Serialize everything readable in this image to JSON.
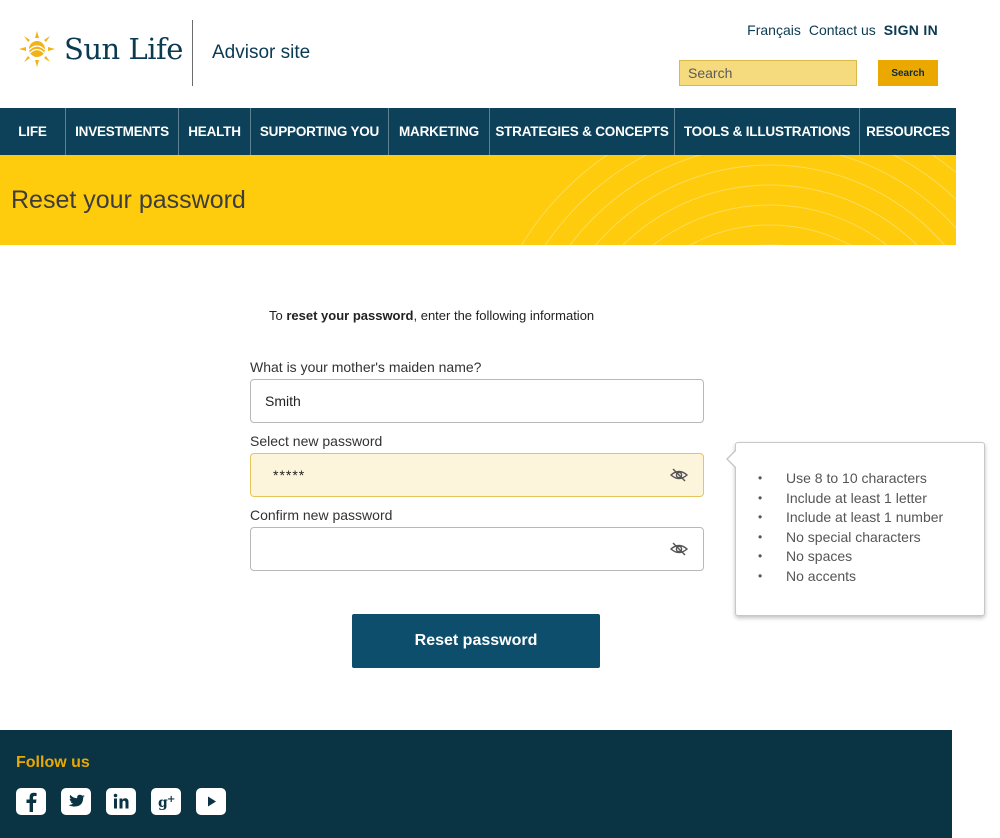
{
  "header": {
    "brand": "Sun Life",
    "site_name": "Advisor site",
    "links": {
      "francais": "Français",
      "contact": "Contact us",
      "signin": "SIGN IN"
    },
    "search": {
      "placeholder": "Search",
      "button_label": "Search"
    }
  },
  "nav": {
    "items": [
      {
        "label": "LIFE"
      },
      {
        "label": "INVESTMENTS"
      },
      {
        "label": "HEALTH"
      },
      {
        "label": "SUPPORTING YOU"
      },
      {
        "label": "MARKETING"
      },
      {
        "label": "STRATEGIES & CONCEPTS"
      },
      {
        "label": "TOOLS & ILLUSTRATIONS"
      },
      {
        "label": "RESOURCES"
      }
    ]
  },
  "banner": {
    "title": "Reset your password"
  },
  "form": {
    "intro_prefix": "To ",
    "intro_bold": "reset your password",
    "intro_suffix": ", enter the following information",
    "maiden_label": "What is your mother's maiden name?",
    "maiden_value": "Smith",
    "new_password_label": "Select new password",
    "new_password_value": "*****",
    "confirm_password_label": "Confirm new password",
    "confirm_password_value": "",
    "submit_label": "Reset password"
  },
  "tooltip": {
    "rules": [
      "Use 8 to 10 characters",
      "Include at least 1 letter",
      "Include at least 1 number",
      "No special characters",
      "No spaces",
      "No accents"
    ]
  },
  "footer": {
    "follow_label": "Follow us",
    "socials": [
      "facebook-icon",
      "twitter-icon",
      "linkedin-icon",
      "google-plus-icon",
      "youtube-icon"
    ]
  },
  "colors": {
    "nav_bg": "#0d4159",
    "banner_bg": "#fecb0d",
    "button_bg": "#0d4e6d",
    "footer_bg": "#0a3443",
    "accent": "#eaa800"
  }
}
